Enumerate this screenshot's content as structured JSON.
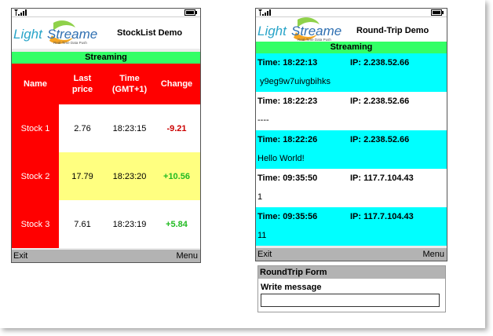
{
  "colors": {
    "streaming_bar": "#33ff66",
    "name_column": "#ff0000",
    "highlight_row": "#ffff80",
    "roundtrip_highlight": "#00ffff",
    "negative": "#cc0000",
    "positive": "#22bb22",
    "softkey_bar": "#b3b3b3"
  },
  "logo": {
    "text_light": "Light",
    "text_streamer": "Streamer",
    "tagline": "Real-Time Data Push"
  },
  "stocklist": {
    "title": "StockList Demo",
    "streaming_label": "Streaming",
    "headers": {
      "name": "Name",
      "last_price_line1": "Last",
      "last_price_line2": "price",
      "time_line1": "Time",
      "time_line2": "(GMT+1)",
      "change": "Change"
    },
    "rows": [
      {
        "name": "Stock 1",
        "price": "2.76",
        "time": "18:23:15",
        "change": "-9.21"
      },
      {
        "name": "Stock 2",
        "price": "17.79",
        "time": "18:23:20",
        "change": "+10.56"
      },
      {
        "name": "Stock 3",
        "price": "7.61",
        "time": "18:23:19",
        "change": "+5.84"
      }
    ],
    "softkeys": {
      "left": "Exit",
      "right": "Menu"
    }
  },
  "roundtrip": {
    "title": "Round-Trip Demo",
    "streaming_label": "Streaming",
    "messages": [
      {
        "time": "Time: 18:22:13",
        "ip": "IP: 2.238.52.66",
        "text": " y9eg9w7uivgbihks"
      },
      {
        "time": "Time: 18:22:23",
        "ip": "IP: 2.238.52.66",
        "text": "----"
      },
      {
        "time": "Time: 18:22:26",
        "ip": "IP: 2.238.52.66",
        "text": "Hello World!"
      },
      {
        "time": "Time: 09:35:50",
        "ip": "IP: 117.7.104.43",
        "text": "1"
      },
      {
        "time": "Time: 09:35:56",
        "ip": "IP: 117.7.104.43",
        "text": "11"
      }
    ],
    "softkeys": {
      "left": "Exit",
      "right": "Menu"
    }
  },
  "form": {
    "title": "RoundTrip Form",
    "label": "Write message",
    "input_value": ""
  }
}
